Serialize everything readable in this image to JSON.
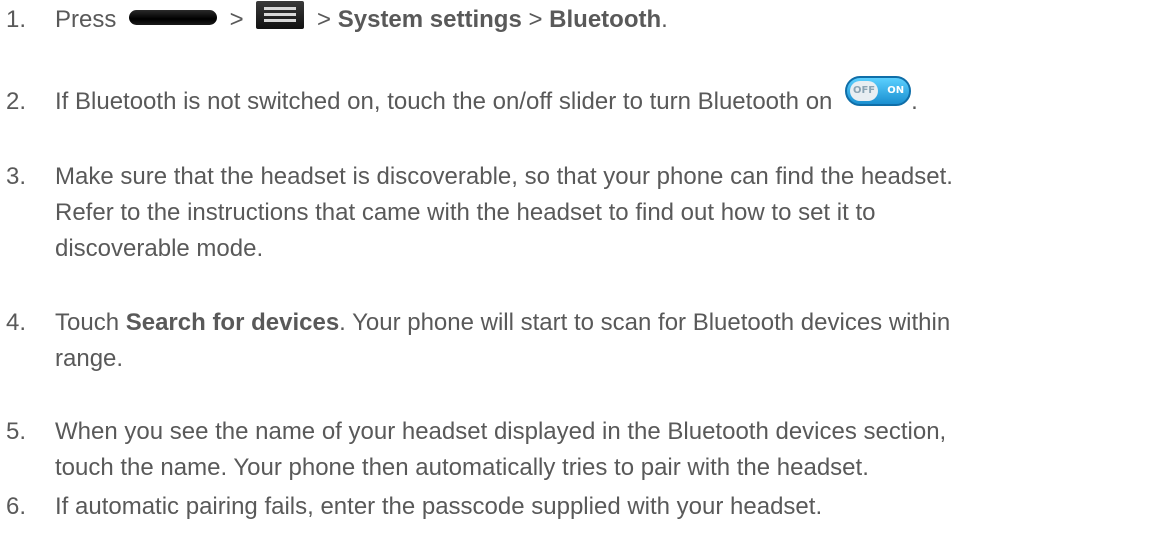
{
  "steps": [
    {
      "number": "1.",
      "parts": {
        "press": "Press ",
        "sep1": " > ",
        "sep2": " > ",
        "system_settings": "System settings",
        "sep3": " > ",
        "bluetooth": "Bluetooth",
        "end": "."
      },
      "icons": [
        "home-key-icon",
        "menu-key-icon"
      ]
    },
    {
      "number": "2.",
      "text": "If Bluetooth is not switched on, touch the on/off slider to turn Bluetooth on ",
      "end": ".",
      "toggle": {
        "off_label": "OFF",
        "on_label": "ON"
      }
    },
    {
      "number": "3.",
      "text": "Make sure that the headset is discoverable, so that your phone can find the headset.\nRefer to the instructions that came with the headset to find out how to set it to\ndiscoverable mode."
    },
    {
      "number": "4.",
      "pre": "Touch ",
      "bold": "Search for devices",
      "post": ". Your phone will start to scan for Bluetooth devices within\nrange."
    },
    {
      "number": "5.",
      "text": "When you see the name of your headset displayed in the Bluetooth devices section,\ntouch the name. Your phone then automatically tries to pair with the headset."
    },
    {
      "number": "6.",
      "text": "If automatic pairing fails, enter the passcode supplied with your headset."
    }
  ],
  "colors": {
    "text": "#595959",
    "toggle_blue": "#1a8fd0"
  }
}
